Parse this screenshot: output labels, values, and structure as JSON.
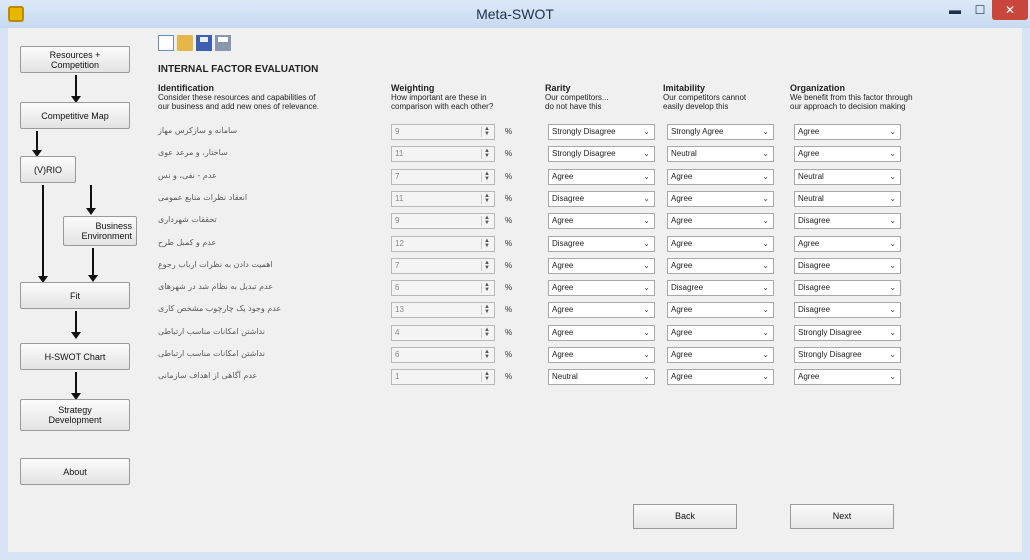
{
  "window": {
    "title": "Meta-SWOT"
  },
  "nav": {
    "resources": "Resources +\nCompetition",
    "competitive_map": "Competitive Map",
    "vrio": "(V)RIO",
    "business_env": "Business\nEnvironment",
    "fit": "Fit",
    "hswot": "H-SWOT Chart",
    "strategy": "Strategy\nDevelopment",
    "about": "About"
  },
  "section_title": "INTERNAL FACTOR EVALUATION",
  "columns": {
    "identification": {
      "title": "Identification",
      "desc1": "Consider these resources and capabilities of",
      "desc2": "our business and add new ones of relevance."
    },
    "weighting": {
      "title": "Weighting",
      "desc1": "How important are these in",
      "desc2": "comparison with each other?"
    },
    "rarity": {
      "title": "Rarity",
      "desc1": "Our competitors...",
      "desc2": "do not have this"
    },
    "imitability": {
      "title": "Imitability",
      "desc1": "Our competitors cannot",
      "desc2": "easily develop this"
    },
    "organization": {
      "title": "Organization",
      "desc1": "We benefit from this factor through",
      "desc2": "our approach to decision making"
    }
  },
  "rows": [
    {
      "label": "سامانه و سازکرس مهاز",
      "weight": "9",
      "rarity": "Strongly Disagree",
      "imitability": "Strongly Agree",
      "organization": "Agree"
    },
    {
      "label": "ساختار، و مرعد عوى",
      "weight": "11",
      "rarity": "Strongly Disagree",
      "imitability": "Neutral",
      "organization": "Agree"
    },
    {
      "label": "عدم - نفی، و نس",
      "weight": "7",
      "rarity": "Agree",
      "imitability": "Agree",
      "organization": "Neutral"
    },
    {
      "label": "انعقاد نظرات منابع عمومی",
      "weight": "11",
      "rarity": "Disagree",
      "imitability": "Agree",
      "organization": "Neutral"
    },
    {
      "label": "تحققات شهرداری",
      "weight": "9",
      "rarity": "Agree",
      "imitability": "Agree",
      "organization": "Disagree"
    },
    {
      "label": "عدم و کمبل طرح",
      "weight": "12",
      "rarity": "Disagree",
      "imitability": "Agree",
      "organization": "Agree"
    },
    {
      "label": "اهمیت دادن به نظرات ارباب رجوع",
      "weight": "7",
      "rarity": "Agree",
      "imitability": "Agree",
      "organization": "Disagree"
    },
    {
      "label": "عدم تبدیل به نظام شد در شهرهای",
      "weight": "6",
      "rarity": "Agree",
      "imitability": "Disagree",
      "organization": "Disagree"
    },
    {
      "label": "عدم وجود یک چارچوب مشخص کاری",
      "weight": "13",
      "rarity": "Agree",
      "imitability": "Agree",
      "organization": "Disagree"
    },
    {
      "label": "نداشتن امکانات مناسب ارتباطی",
      "weight": "4",
      "rarity": "Agree",
      "imitability": "Agree",
      "organization": "Strongly Disagree"
    },
    {
      "label": "نداشتن امکانات مناسب ارتباطی",
      "weight": "6",
      "rarity": "Agree",
      "imitability": "Agree",
      "organization": "Strongly Disagree"
    },
    {
      "label": "عدم آگاهی از اهداف سازمانی",
      "weight": "1",
      "rarity": "Neutral",
      "imitability": "Agree",
      "organization": "Agree"
    }
  ],
  "pct_symbol": "%",
  "buttons": {
    "back": "Back",
    "next": "Next"
  }
}
